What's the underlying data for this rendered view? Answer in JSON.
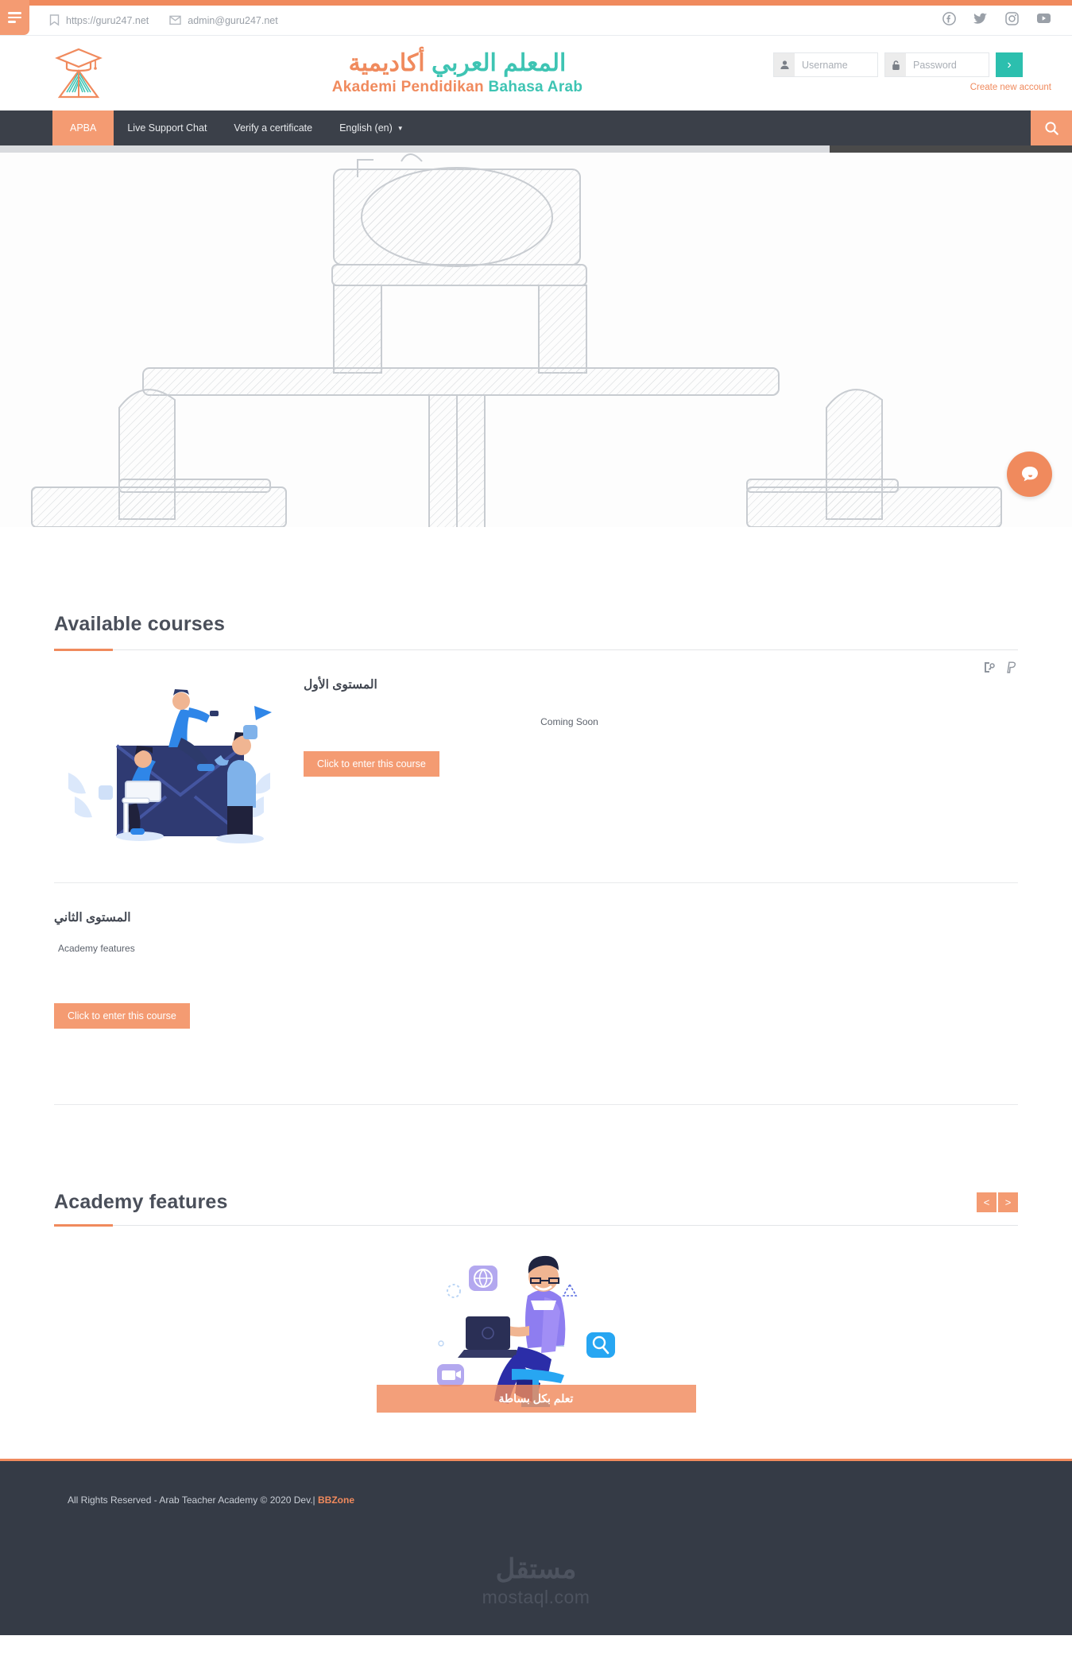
{
  "utility_bar": {
    "menu_icon": "hamburger-icon",
    "links": [
      {
        "icon": "bookmark-icon",
        "label": "https://guru247.net"
      },
      {
        "icon": "envelope-icon",
        "label": "admin@guru247.net"
      }
    ],
    "social": [
      {
        "icon": "facebook-icon",
        "label": "Facebook"
      },
      {
        "icon": "twitter-icon",
        "label": "Twitter"
      },
      {
        "icon": "instagram-icon",
        "label": "Instagram"
      },
      {
        "icon": "youtube-icon",
        "label": "YouTube"
      }
    ]
  },
  "header": {
    "logo_icon": "graduation-book-logo",
    "title_ar_orange": "أكاديمية",
    "title_ar_teal": "المعلم العربي",
    "title_en_orange": "Akademi Pendidikan",
    "title_en_teal": "Bahasa Arab",
    "login": {
      "username_placeholder": "Username",
      "password_placeholder": "Password",
      "username_value": "",
      "password_value": "",
      "username_icon": "user-icon",
      "password_icon": "lock-icon",
      "submit_label": "›",
      "create_account_label": "Create new account"
    }
  },
  "nav": {
    "items": [
      {
        "label": "APBA",
        "active": true
      },
      {
        "label": "Live Support Chat",
        "active": false
      },
      {
        "label": "Verify a certificate",
        "active": false
      },
      {
        "label": "English (en)",
        "active": false,
        "has_caret": true
      }
    ],
    "search_icon": "search-icon"
  },
  "hero": {
    "banner_alt": "classroom-line-art-banner",
    "scroll_thumb_percent": 77,
    "chat_widget_icon": "chat-bubble-icon"
  },
  "courses_section": {
    "title": "Available courses",
    "courses": [
      {
        "name": "المستوى الأول",
        "summary": "Coming Soon",
        "button_label": "Click to enter this course",
        "thumb_alt": "envelope-teamwork-illustration",
        "icons": [
          {
            "name": "enrolment-key-icon"
          },
          {
            "name": "paypal-icon"
          }
        ]
      },
      {
        "name": "المستوى الثاني",
        "summary": "Academy features",
        "button_label": "Click to enter this course",
        "thumb_alt": "",
        "icons": []
      }
    ]
  },
  "features_section": {
    "title": "Academy features",
    "prev_label": "<",
    "next_label": ">",
    "slides": [
      {
        "caption": "تعلم بكل بساطة",
        "image_alt": "man-working-on-laptop-illustration"
      }
    ]
  },
  "footer": {
    "copyright": "All Rights Reserved - Arab Teacher Academy © 2020 Dev.|",
    "brand": "BBZone",
    "watermark_ar": "مستقل",
    "watermark_en": "mostaql.com"
  },
  "colors": {
    "orange": "#f08a5d",
    "orange_light": "#f49b72",
    "teal": "#2cbfae",
    "dark": "#3b4049",
    "footer_dark": "#353b46"
  }
}
